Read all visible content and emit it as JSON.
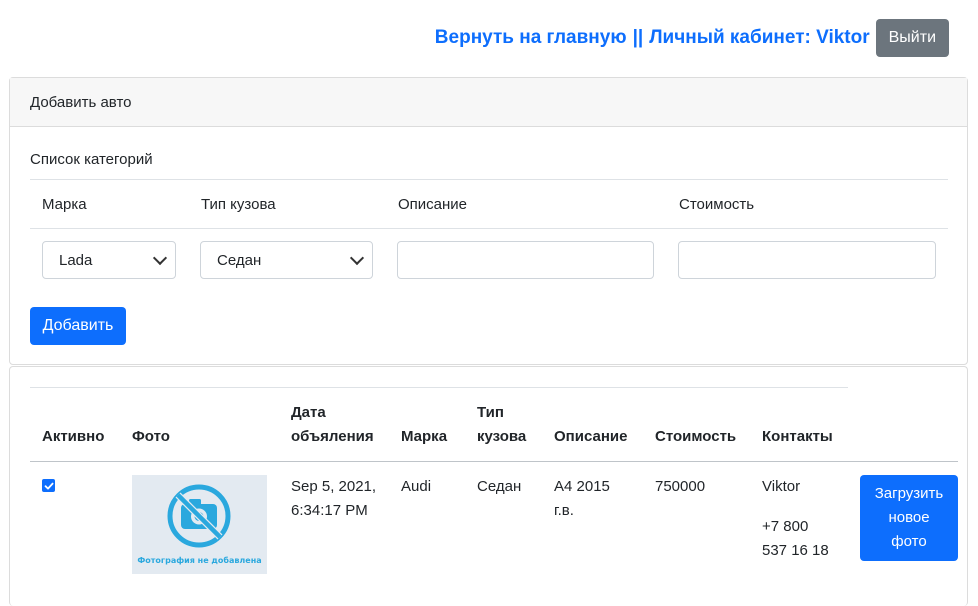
{
  "header": {
    "home_link": "Вернуть на главную",
    "separator": "||",
    "cabinet_link": "Личный кабинет: Viktor",
    "logout_label": "Выйти"
  },
  "add_form": {
    "title": "Добавить авто",
    "category_list": "Список категорий",
    "labels": {
      "brand": "Марка",
      "body": "Тип кузова",
      "description": "Описание",
      "price": "Стоимость"
    },
    "brand_value": "Lada",
    "body_value": "Седан",
    "description_value": "",
    "price_value": "",
    "add_label": "Добавить"
  },
  "table": {
    "headers": {
      "active": "Активно",
      "photo": "Фото",
      "date_line1": "Дата",
      "date_line2": "объяления",
      "brand": "Марка",
      "body_line1": "Тип",
      "body_line2": "кузова",
      "description": "Описание",
      "price": "Стоимость",
      "contacts": "Контакты"
    },
    "rows": [
      {
        "active": true,
        "photo_caption": "Фотография не добавлена",
        "date_line1": "Sep 5, 2021,",
        "date_line2": "6:34:17 PM",
        "brand": "Audi",
        "body": "Седан",
        "description_line1": "A4 2015",
        "description_line2": "г.в.",
        "price": "750000",
        "contact_name": "Viktor",
        "phone_line1": "+7 800",
        "phone_line2": "537 16 18",
        "upload_line1": "Загрузить",
        "upload_line2": "новое",
        "upload_line3": "фото"
      }
    ]
  },
  "colors": {
    "primary": "#0d6efd",
    "secondary": "#6c757d",
    "photo_icon": "#2aa8de"
  }
}
